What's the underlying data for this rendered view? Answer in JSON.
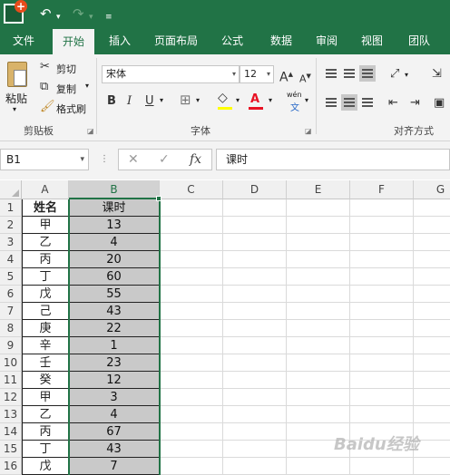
{
  "quick_access": {
    "app_icon": "excel-icon",
    "undo_icon": "undo-icon",
    "redo_icon": "redo-icon",
    "customize_icon": "customize-icon"
  },
  "tabs": [
    "文件",
    "开始",
    "插入",
    "页面布局",
    "公式",
    "数据",
    "审阅",
    "视图",
    "团队"
  ],
  "active_tab": "开始",
  "ribbon": {
    "clipboard": {
      "paste": "粘贴",
      "cut": "剪切",
      "copy": "复制",
      "format_painter": "格式刷",
      "group_label": "剪贴板"
    },
    "font": {
      "font_name": "宋体",
      "font_size": "12",
      "grow": "A",
      "shrink": "A",
      "bold": "B",
      "italic": "I",
      "underline": "U",
      "phonetic": "wén",
      "phonetic_sub": "文",
      "font_color_letter": "A",
      "group_label": "字体",
      "fill_color": "#ffff00",
      "font_color": "#e81123"
    },
    "alignment": {
      "group_label": "对齐方式"
    }
  },
  "formula_bar": {
    "name_box": "B1",
    "cancel": "✕",
    "enter": "✓",
    "fx": "fx",
    "content": "课时"
  },
  "columns": [
    "A",
    "B",
    "C",
    "D",
    "E",
    "F",
    "G"
  ],
  "rows": [
    {
      "num": "1",
      "a": "姓名",
      "b": "课时"
    },
    {
      "num": "2",
      "a": "甲",
      "b": "13"
    },
    {
      "num": "3",
      "a": "乙",
      "b": "4"
    },
    {
      "num": "4",
      "a": "丙",
      "b": "20"
    },
    {
      "num": "5",
      "a": "丁",
      "b": "60"
    },
    {
      "num": "6",
      "a": "戊",
      "b": "55"
    },
    {
      "num": "7",
      "a": "己",
      "b": "43"
    },
    {
      "num": "8",
      "a": "庚",
      "b": "22"
    },
    {
      "num": "9",
      "a": "辛",
      "b": "1"
    },
    {
      "num": "10",
      "a": "壬",
      "b": "23"
    },
    {
      "num": "11",
      "a": "癸",
      "b": "12"
    },
    {
      "num": "12",
      "a": "甲",
      "b": "3"
    },
    {
      "num": "13",
      "a": "乙",
      "b": "4"
    },
    {
      "num": "14",
      "a": "丙",
      "b": "67"
    },
    {
      "num": "15",
      "a": "丁",
      "b": "43"
    },
    {
      "num": "16",
      "a": "戊",
      "b": "7"
    }
  ],
  "selected_column": "B",
  "colors": {
    "accent": "#217346",
    "selected_fill": "#c9c9c9"
  },
  "watermark": "Baidu经验"
}
